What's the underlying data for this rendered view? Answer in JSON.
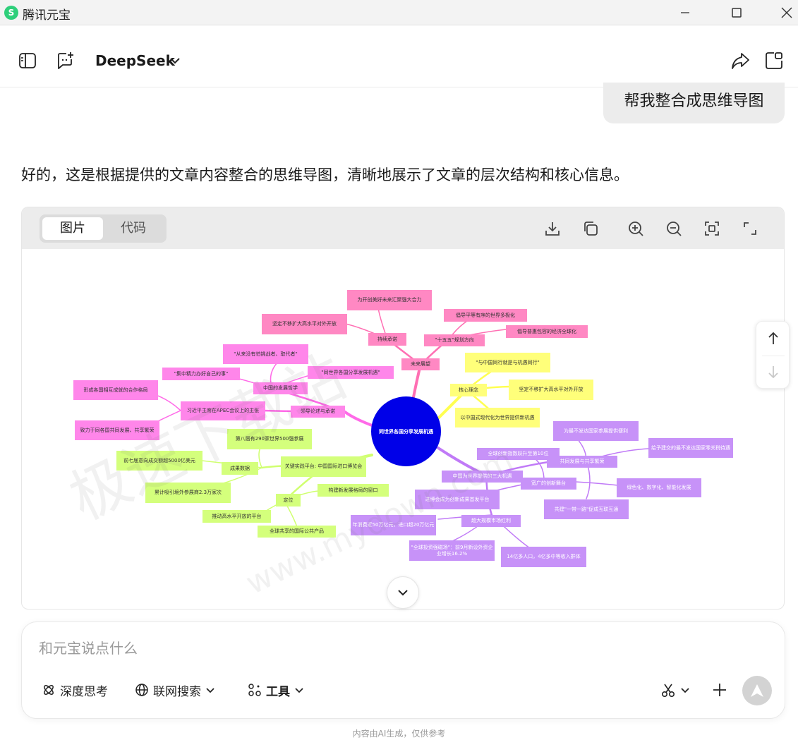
{
  "window": {
    "app_title": "腾讯元宝",
    "logo_glyph": "S",
    "buttons": [
      "minimize-icon",
      "maximize-icon",
      "close-icon"
    ]
  },
  "header": {
    "model_name": "DeepSeek",
    "icons": [
      "sidebar-icon",
      "new-chat-icon",
      "chevron-down-icon",
      "share-icon",
      "open-window-icon"
    ]
  },
  "chat": {
    "user_message": "帮我整合成思维导图",
    "assistant_intro": "好的，这是根据提供的文章内容整合的思维导图，清晰地展示了文章的层次结构和核心信息。"
  },
  "mindmap_panel": {
    "tabs": [
      {
        "label": "图片",
        "active": true
      },
      {
        "label": "代码",
        "active": false
      }
    ],
    "toolbar_icons": [
      "download-icon",
      "copy-icon",
      "zoom-in-icon",
      "zoom-out-icon",
      "fit-screen-icon",
      "fullscreen-icon"
    ],
    "root": "同世界各国分享发展机遇",
    "nodes": {
      "future": "未来展望",
      "sustained": "持续承诺",
      "sustained_1": "为开创美好未来汇聚强大合力",
      "sustained_2": "坚定不移扩大高水平对外开放",
      "plan": "\"十五五\"规划方向",
      "plan_1": "倡导平等有序的世界多极化",
      "plan_2": "倡导普惠包容的经济全球化",
      "core": "核心理念",
      "core_1": "\"与中国同行就是与机遇同行\"",
      "core_2": "坚定不移扩大高水平对外开放",
      "core_3": "以中国式现代化为世界提供新机遇",
      "leader": "领导论述与承诺",
      "philosophy": "中国的发展哲学",
      "phil_1": "\"从来没有怕挑战者、取代者\"",
      "phil_2": "\"集中精力办好自己的事\"",
      "phil_3": "\"同世界各国分享发展机遇\"",
      "apec": "习近平主席在APEC会议上的主张",
      "apec_1": "形成各国相互成就的合作格局",
      "apec_2": "致力于同各国共同发展、共享繁荣",
      "platform": "关键实践平台: 中国国际进口博览会",
      "results": "成果数据",
      "res_1": "第八届有290家世界500强参展",
      "res_2": "前七届意向成交额超5000亿美元",
      "res_3": "累计吸引境外参展商2.3万家次",
      "position": "定位",
      "pos_1": "构建新发展格局的窗口",
      "pos_2": "推动高水平开放的平台",
      "pos_3": "全球共享的国际公共产品",
      "three": "中国为世界提供的三大机遇",
      "innovation": "宽广的创新舞台",
      "inn_1": "全球创新指数跃升至第10位",
      "inn_2": "绿色化、数字化、智能化发展",
      "inn_3": "进博会成为创新成果首发平台",
      "shared": "共同发展与共享繁荣",
      "sh_1": "为最不发达国家参展提供便利",
      "sh_2": "给予建交的最不发达国家零关税待遇",
      "sh_3": "共建\"一带一路\"促成互联互通",
      "market": "超大规模市场红利",
      "mk_1": "年消费近50万亿元，进口超20万亿元",
      "mk_2": "\"全球投资强磁场\"：前9月新设外资企业增长16.2%",
      "mk_3": "14亿多人口，4亿多中等收入群体"
    }
  },
  "watermark": {
    "main": "极速下载站",
    "sub": "www.mydown.com"
  },
  "composer": {
    "placeholder": "和元宝说点什么",
    "tools": {
      "deep_think": "深度思考",
      "web_search": "联网搜索",
      "tools": "工具"
    }
  },
  "footer": {
    "note": "内容由AI生成，仅供参考"
  }
}
